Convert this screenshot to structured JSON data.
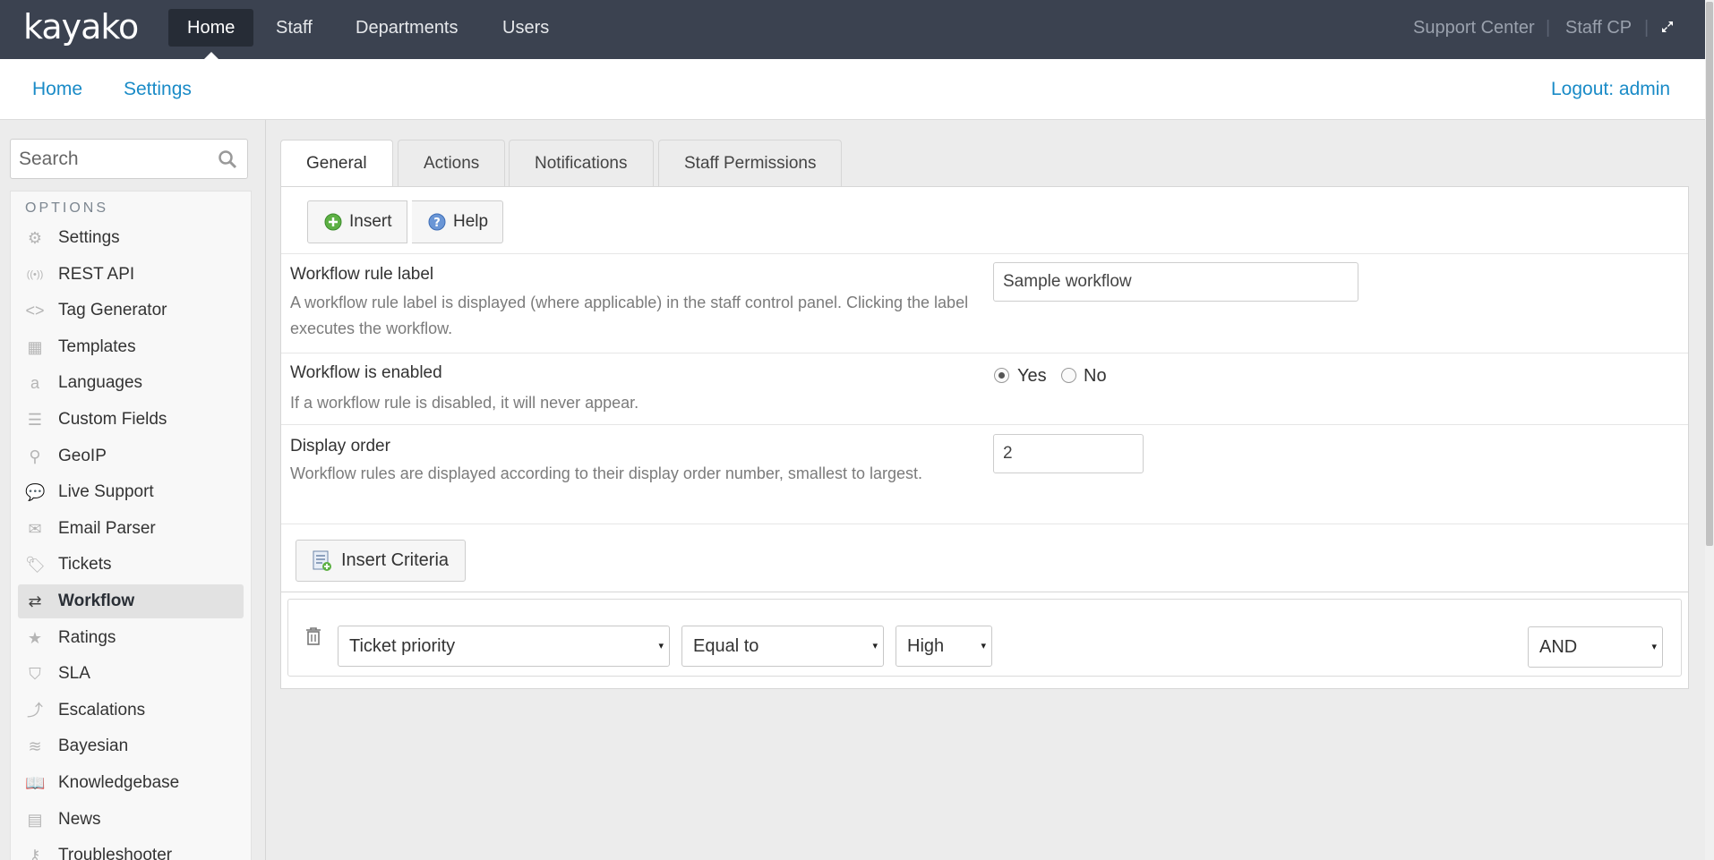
{
  "app": {
    "logo": "kayako"
  },
  "topnav": {
    "items": [
      {
        "label": "Home"
      },
      {
        "label": "Staff"
      },
      {
        "label": "Departments"
      },
      {
        "label": "Users"
      }
    ],
    "right": {
      "support_center": "Support Center",
      "staff_cp": "Staff CP",
      "sep": "|"
    },
    "icons": {
      "expand": "external-link-icon"
    }
  },
  "subnav": {
    "home": "Home",
    "settings": "Settings",
    "logout": "Logout: admin"
  },
  "sidebar": {
    "search_placeholder": "Search",
    "options_title": "OPTIONS",
    "items": [
      {
        "label": "Settings",
        "icon": "gear-icon",
        "glyph": "⚙"
      },
      {
        "label": "REST API",
        "icon": "broadcast-icon",
        "glyph": "((•))"
      },
      {
        "label": "Tag Generator",
        "icon": "code-icon",
        "glyph": "<>"
      },
      {
        "label": "Templates",
        "icon": "template-icon",
        "glyph": "▦"
      },
      {
        "label": "Languages",
        "icon": "language-icon",
        "glyph": "a"
      },
      {
        "label": "Custom Fields",
        "icon": "list-icon",
        "glyph": "☰"
      },
      {
        "label": "GeoIP",
        "icon": "map-pin-icon",
        "glyph": "⚲"
      },
      {
        "label": "Live Support",
        "icon": "chat-icon",
        "glyph": "💬"
      },
      {
        "label": "Email Parser",
        "icon": "envelope-icon",
        "glyph": "✉"
      },
      {
        "label": "Tickets",
        "icon": "ticket-icon",
        "glyph": "🏷"
      },
      {
        "label": "Workflow",
        "icon": "shuffle-icon",
        "glyph": "⇄",
        "active": true
      },
      {
        "label": "Ratings",
        "icon": "star-icon",
        "glyph": "★"
      },
      {
        "label": "SLA",
        "icon": "shield-icon",
        "glyph": "⛉"
      },
      {
        "label": "Escalations",
        "icon": "escalation-icon",
        "glyph": "⤴"
      },
      {
        "label": "Bayesian",
        "icon": "layers-icon",
        "glyph": "≋"
      },
      {
        "label": "Knowledgebase",
        "icon": "book-icon",
        "glyph": "📖"
      },
      {
        "label": "News",
        "icon": "newspaper-icon",
        "glyph": "▤"
      },
      {
        "label": "Troubleshooter",
        "icon": "troubleshooter-icon",
        "glyph": "⚷"
      }
    ]
  },
  "tabs": [
    {
      "label": "General",
      "active": true
    },
    {
      "label": "Actions"
    },
    {
      "label": "Notifications"
    },
    {
      "label": "Staff Permissions"
    }
  ],
  "toolbar": {
    "insert": "Insert",
    "help": "Help"
  },
  "form": {
    "label_title": "Workflow rule label",
    "label_desc": "A workflow rule label is displayed (where applicable) in the staff control panel. Clicking the label executes the workflow.",
    "label_value": "Sample workflow",
    "enabled_title": "Workflow is enabled",
    "enabled_desc": "If a workflow rule is disabled, it will never appear.",
    "enabled_yes": "Yes",
    "enabled_no": "No",
    "enabled_value": "Yes",
    "order_title": "Display order",
    "order_desc": "Workflow rules are displayed according to their display order number, smallest to largest.",
    "order_value": "2"
  },
  "criteria": {
    "insert_button": "Insert Criteria",
    "field": "Ticket priority",
    "operator": "Equal to",
    "value": "High",
    "join": "AND",
    "arrow": "▾"
  },
  "colors": {
    "topbar": "#3b4250",
    "link": "#1a8bc7"
  }
}
